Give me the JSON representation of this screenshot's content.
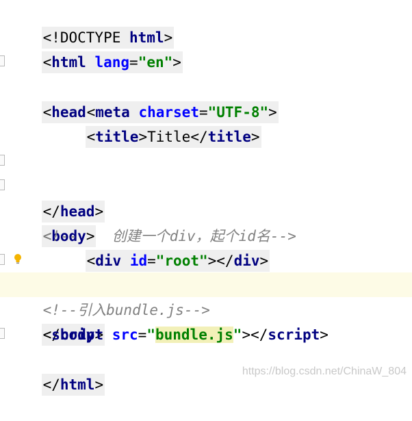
{
  "editor": {
    "lines": [
      {
        "doctype": "<!DOCTYPE ",
        "html": "html",
        "close": ">"
      },
      {
        "open": "<",
        "tag": "html",
        "attr": " lang",
        "eq": "=",
        "value": "\"en\"",
        "close": ">"
      },
      {
        "open": "<",
        "tag": "head",
        "close": ">"
      },
      {
        "open": "<",
        "tag": "meta",
        "attr": " charset",
        "eq": "=",
        "value": "\"UTF-8\"",
        "close": ">"
      },
      {
        "open": "<",
        "tag": "title",
        "close": ">",
        "text": "Title",
        "end_open": "</",
        "end_tag": "title",
        "end_close": ">"
      },
      {},
      {
        "open": "</",
        "tag": "head",
        "close": ">"
      },
      {
        "open": "<",
        "tag": "body",
        "close": ">"
      },
      {
        "comment": "<!--    创建一个div，起个id名-->"
      },
      {
        "open": "<",
        "tag": "div",
        "attr": " id",
        "eq": "=",
        "value": "\"root\"",
        "close": ">",
        "end_open": "</",
        "end_tag": "div",
        "end_close": ">"
      },
      {
        "open": "</",
        "tag": "body",
        "close": ">"
      },
      {
        "comment": "<!--引入bundle.js-->"
      },
      {
        "open": "<",
        "tag": "script",
        "attr": " src",
        "eq": "=",
        "value_quote_open": "\"",
        "value": "bundle.js",
        "value_quote_close": "\"",
        "close": ">",
        "end_open": "</",
        "end_tag": "script",
        "end_close": ">"
      },
      {
        "open": "</",
        "tag": "html",
        "close": ">"
      }
    ]
  },
  "gutter": {
    "fold_marks": [
      "line-3",
      "line-7",
      "line-8",
      "line-11",
      "line-14"
    ],
    "intention_icon": "lightbulb-icon"
  },
  "colors": {
    "tag": "#000080",
    "attribute": "#0000ff",
    "string": "#008000",
    "comment": "#808080",
    "current_line": "#fdfbe6",
    "tag_background": "#efefef"
  },
  "watermark": "https://blog.csdn.net/ChinaW_804"
}
